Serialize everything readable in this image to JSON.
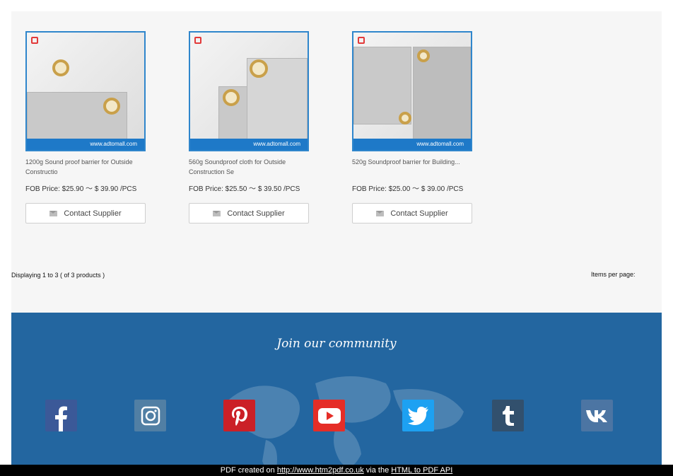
{
  "products": [
    {
      "title": "1200g Sound proof barrier for Outside Constructio",
      "price": "FOB Price: $25.90 ～ $ 39.90 /PCS",
      "button": "Contact Supplier",
      "watermark": "www.adtomall.com"
    },
    {
      "title": "560g Soundproof cloth for Outside Construction Se",
      "price": "FOB Price: $25.50 ～ $ 39.50 /PCS",
      "button": "Contact Supplier",
      "watermark": "www.adtomall.com"
    },
    {
      "title": "520g Soundproof barrier for Building...",
      "price": "FOB Price: $25.00 ～ $ 39.00 /PCS",
      "button": "Contact Supplier",
      "watermark": "www.adtomall.com"
    }
  ],
  "pagination": {
    "display": "Displaying 1 to 3 ( of 3 products )",
    "items_per_page": "Items per page:"
  },
  "community": {
    "title": "Join our community",
    "socials": [
      {
        "name": "facebook-icon",
        "color": "#3b5998"
      },
      {
        "name": "instagram-icon",
        "color": "#517fa4"
      },
      {
        "name": "pinterest-icon",
        "color": "#cb2027"
      },
      {
        "name": "youtube-icon",
        "color": "#e52d27"
      },
      {
        "name": "twitter-icon",
        "color": "#1da1f2"
      },
      {
        "name": "tumblr-icon",
        "color": "#32506d"
      },
      {
        "name": "vk-icon",
        "color": "#4c75a3"
      }
    ]
  },
  "footer": {
    "prefix": "PDF created on ",
    "link1": "http://www.htm2pdf.co.uk",
    "middle": " via the ",
    "link2": "HTML to PDF API"
  }
}
